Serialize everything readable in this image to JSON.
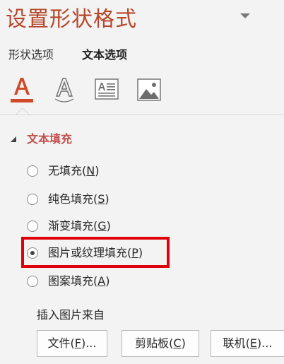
{
  "pane": {
    "title": "设置形状格式"
  },
  "tabs": {
    "shape_options": "形状选项",
    "text_options": "文本选项"
  },
  "icons": {
    "text_fill": "text-fill-icon",
    "text_outline": "text-outline-icon",
    "text_box": "text-box-icon",
    "picture": "picture-icon"
  },
  "section": {
    "title": "文本填充"
  },
  "fill_options": [
    {
      "label": "无填充",
      "mnemonic": "N",
      "selected": false
    },
    {
      "label": "纯色填充",
      "mnemonic": "S",
      "selected": false
    },
    {
      "label": "渐变填充",
      "mnemonic": "G",
      "selected": false
    },
    {
      "label": "图片或纹理填充",
      "mnemonic": "P",
      "selected": true
    },
    {
      "label": "图案填充",
      "mnemonic": "A",
      "selected": false
    }
  ],
  "insert_picture": {
    "label": "插入图片来自",
    "buttons": [
      {
        "label": "文件",
        "mnemonic": "F",
        "suffix": "..."
      },
      {
        "label": "剪贴板",
        "mnemonic": "C",
        "suffix": ""
      },
      {
        "label": "联机",
        "mnemonic": "E",
        "suffix": "..."
      }
    ]
  },
  "colors": {
    "accent": "#c0504d",
    "title": "#b7472a",
    "highlight": "#e0000a"
  }
}
